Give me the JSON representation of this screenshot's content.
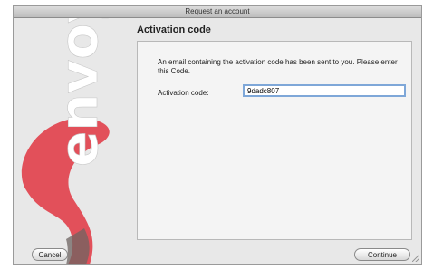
{
  "window": {
    "title": "Request an account"
  },
  "logo": {
    "text": "envoy",
    "icon": "envoy-logo",
    "colors": {
      "swoosh": "#e2505a",
      "text": "#ffffff",
      "shadow": "#6d6462"
    }
  },
  "page": {
    "heading": "Activation code",
    "message": "An email containing the activation code has been sent to you. Please enter this Code.",
    "code_label": "Activation code:",
    "code_value": "9dadc807"
  },
  "buttons": {
    "cancel": "Cancel",
    "continue": "Continue"
  },
  "colors": {
    "focus_ring": "#7ea7d8",
    "background": "#e8e8e8"
  }
}
